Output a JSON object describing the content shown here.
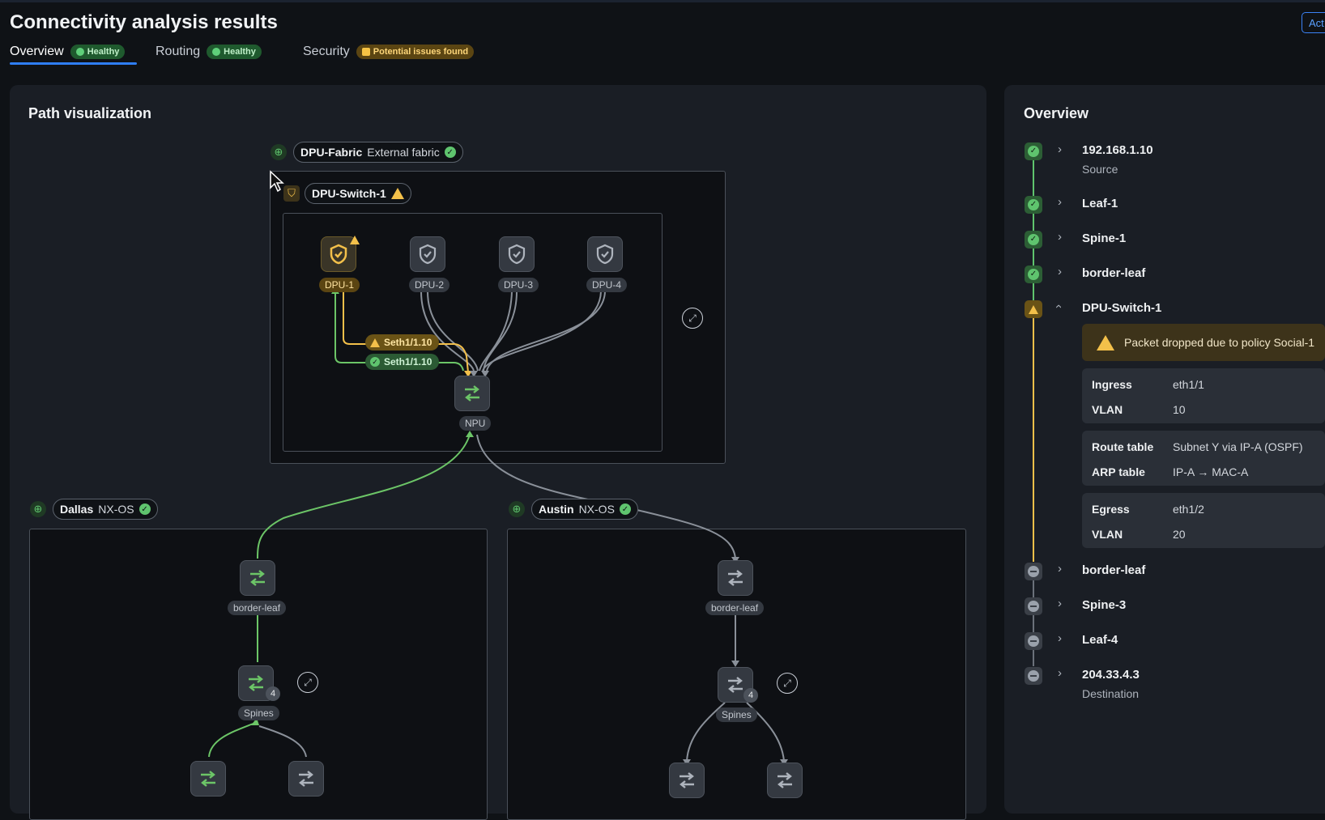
{
  "header": {
    "title": "Connectivity analysis results",
    "action_button": "Act"
  },
  "tabs": [
    {
      "label": "Overview",
      "badge": "Healthy",
      "status": "ok"
    },
    {
      "label": "Routing",
      "badge": "Healthy",
      "status": "ok"
    },
    {
      "label": "Security",
      "badge": "Potential issues found",
      "status": "warn"
    }
  ],
  "path_panel": {
    "title": "Path visualization",
    "dpu_fabric": {
      "name": "DPU-Fabric",
      "type": "External fabric"
    },
    "dpu_switch": {
      "name": "DPU-Switch-1"
    },
    "dpus": [
      "DPU-1",
      "DPU-2",
      "DPU-3",
      "DPU-4"
    ],
    "npu": "NPU",
    "links": [
      {
        "label": "Seth1/1.10",
        "status": "warn"
      },
      {
        "label": "Seth1/1.10",
        "status": "ok"
      }
    ],
    "sites": [
      {
        "name": "Dallas",
        "os": "NX-OS",
        "border": "border-leaf",
        "spines": "Spines",
        "spine_count": "4"
      },
      {
        "name": "Austin",
        "os": "NX-OS",
        "border": "border-leaf",
        "spines": "Spines",
        "spine_count": "4"
      }
    ]
  },
  "overview_panel": {
    "title": "Overview",
    "hops": [
      {
        "name": "192.168.1.10",
        "sub": "Source",
        "status": "ok",
        "expanded": false
      },
      {
        "name": "Leaf-1",
        "sub": "",
        "status": "ok",
        "expanded": false
      },
      {
        "name": "Spine-1",
        "sub": "",
        "status": "ok",
        "expanded": false
      },
      {
        "name": "border-leaf",
        "sub": "",
        "status": "ok",
        "expanded": false
      },
      {
        "name": "DPU-Switch-1",
        "sub": "",
        "status": "warn",
        "expanded": true
      },
      {
        "name": "border-leaf",
        "sub": "",
        "status": "off",
        "expanded": false
      },
      {
        "name": "Spine-3",
        "sub": "",
        "status": "off",
        "expanded": false
      },
      {
        "name": "Leaf-4",
        "sub": "",
        "status": "off",
        "expanded": false
      },
      {
        "name": "204.33.4.3",
        "sub": "Destination",
        "status": "off",
        "expanded": false
      }
    ],
    "alert": "Packet dropped due to policy Social-1",
    "details": [
      [
        {
          "k": "Ingress",
          "v": "eth1/1"
        },
        {
          "k": "VLAN",
          "v": "10"
        }
      ],
      [
        {
          "k": "Route table",
          "v": "Subnet Y via IP-A (OSPF)"
        },
        {
          "k": "ARP table",
          "v": "IP-A → MAC-A"
        }
      ],
      [
        {
          "k": "Egress",
          "v": "eth1/2"
        },
        {
          "k": "VLAN",
          "v": "20"
        }
      ]
    ]
  },
  "colors": {
    "ok": "#5fc46e",
    "warn": "#f3c04a",
    "accent": "#2f7ef5",
    "background": "#0f1216"
  }
}
